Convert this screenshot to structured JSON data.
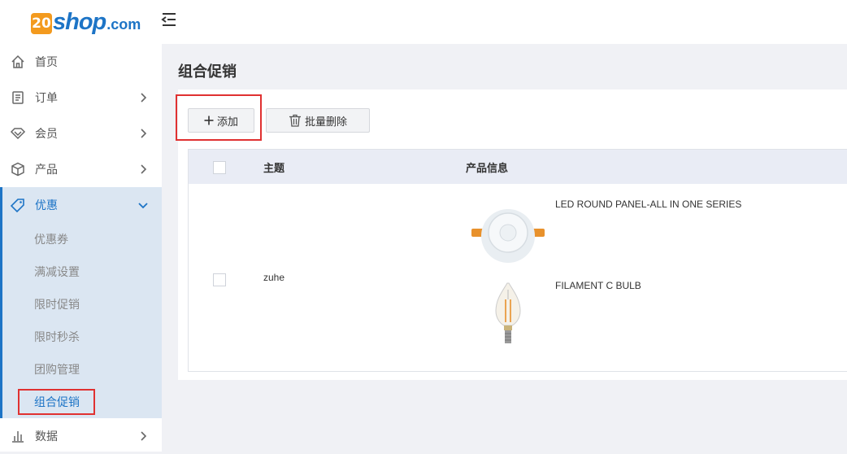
{
  "header": {
    "logo_badge": "20",
    "logo_word": "shop",
    "logo_suffix": ".com",
    "collapse_icon": "menu-collapse-icon"
  },
  "sidebar": {
    "items": [
      {
        "label": "首页",
        "icon": "home-icon"
      },
      {
        "label": "订单",
        "icon": "order-icon"
      },
      {
        "label": "会员",
        "icon": "member-icon"
      },
      {
        "label": "产品",
        "icon": "product-icon"
      },
      {
        "label": "优惠",
        "icon": "tag-icon"
      },
      {
        "label": "数据",
        "icon": "chart-icon"
      }
    ],
    "promo_sub": [
      "优惠券",
      "满减设置",
      "限时促销",
      "限时秒杀",
      "团购管理",
      "组合促销"
    ]
  },
  "main": {
    "title": "组合促销",
    "add_label": "添加",
    "batch_delete_label": "批量删除",
    "table": {
      "col_subject": "主题",
      "col_product_info": "产品信息",
      "rows": [
        {
          "subject": "zuhe",
          "products": [
            {
              "name": "LED ROUND PANEL-ALL IN ONE SERIES"
            },
            {
              "name": "FILAMENT C BULB"
            }
          ]
        }
      ]
    }
  },
  "colors": {
    "accent": "#1d74c6",
    "highlight_border": "#e03131",
    "logo_orange": "#f39a1e"
  }
}
